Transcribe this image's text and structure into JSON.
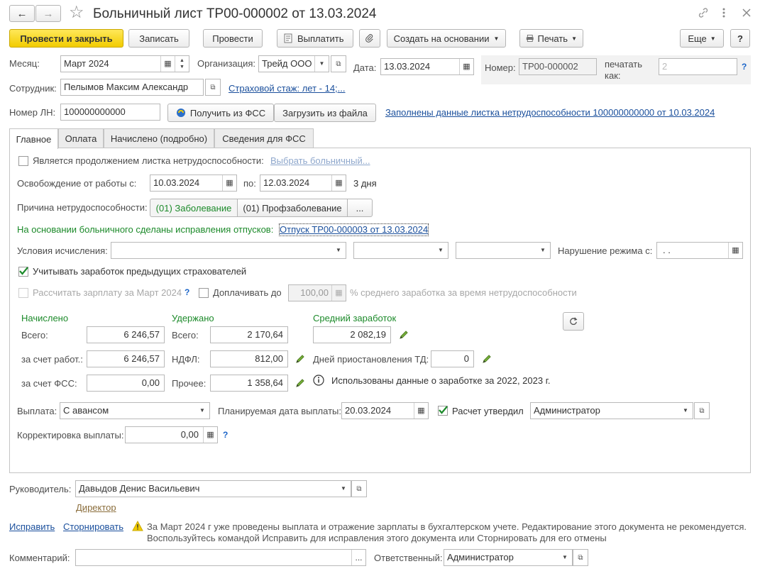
{
  "window": {
    "title": "Больничный лист ТР00-000002 от 13.03.2024",
    "back": "←",
    "forward": "→",
    "star": "☆"
  },
  "toolbar": {
    "post_close": "Провести и закрыть",
    "save": "Записать",
    "post": "Провести",
    "pay": "Выплатить",
    "create_based": "Создать на основании",
    "print": "Печать",
    "more": "Еще",
    "help": "?"
  },
  "header": {
    "month_label": "Месяц:",
    "month_value": "Март 2024",
    "org_label": "Организация:",
    "org_value": "Трейд ООО",
    "date_label": "Дата:",
    "date_value": "13.03.2024",
    "number_label": "Номер:",
    "number_value": "ТР00-000002",
    "print_as_label1": "печатать",
    "print_as_label2": "как:",
    "print_as_value": "2",
    "help": "?",
    "employee_label": "Сотрудник:",
    "employee_value": "Пелымов Максим Александр",
    "insurance_link": "Страховой стаж: лет - 14;...",
    "ln_label": "Номер ЛН:",
    "ln_value": "100000000000",
    "get_fss": "Получить из ФСС",
    "load_file": "Загрузить из файла",
    "filled_link": "Заполнены данные листка нетрудоспособности 100000000000 от 10.03.2024"
  },
  "tabs": [
    {
      "label": "Главное"
    },
    {
      "label": "Оплата"
    },
    {
      "label": "Начислено (подробно)"
    },
    {
      "label": "Сведения для ФСС"
    }
  ],
  "main": {
    "continuation_label": "Является продолжением листка нетрудоспособности:",
    "choose_sick": "Выбрать больничный...",
    "release_label": "Освобождение от работы с:",
    "release_from": "10.03.2024",
    "to_label": "по:",
    "release_to": "12.03.2024",
    "days": "3 дня",
    "reason_label": "Причина нетрудоспособности:",
    "reason_opt1": "(01) Заболевание",
    "reason_opt2": "(01) Профзаболевание",
    "reason_more": "...",
    "vacation_note": "На основании больничного сделаны исправления отпусков:",
    "vacation_link": "Отпуск ТР00-000003 от 13.03.2024",
    "conditions_label": "Условия исчисления:",
    "violation_label": "Нарушение режима с:",
    "violation_value": " .  .",
    "prev_insurers_label": "Учитывать заработок предыдущих страхователей",
    "calc_salary_label": "Рассчитать зарплату за Март 2024",
    "calc_help": "?",
    "extra_pay_label": "Доплачивать до",
    "extra_pay_value": "100,00",
    "extra_pay_suffix": "% среднего заработка за время нетрудоспособности",
    "accrued_title": "Начислено",
    "withheld_title": "Удержано",
    "avg_title": "Средний заработок",
    "total_label": "Всего:",
    "accrued_total": "6 246,57",
    "employer_label": "за счет работ.:",
    "accrued_employer": "6 246,57",
    "fss_label": "за счет ФСС:",
    "accrued_fss": "0,00",
    "withheld_total_label": "Всего:",
    "withheld_total": "2 170,64",
    "ndfl_label": "НДФЛ:",
    "ndfl_value": "812,00",
    "other_label": "Прочее:",
    "other_value": "1 358,64",
    "avg_value": "2 082,19",
    "suspension_label": "Дней приостановления ТД:",
    "suspension_value": "0",
    "info_text": "Использованы данные о заработке за  2022,  2023 г.",
    "payout_label": "Выплата:",
    "payout_value": "С авансом",
    "planned_date_label": "Планируемая дата выплаты:",
    "planned_date_value": "20.03.2024",
    "approved_label": "Расчет утвердил",
    "approved_value": "Администратор",
    "correction_label": "Корректировка выплаты:",
    "correction_value": "0,00",
    "correction_help": "?"
  },
  "footer": {
    "manager_label": "Руководитель:",
    "manager_value": "Давыдов Денис Васильевич",
    "position_link": "Директор",
    "fix_link": "Исправить",
    "reverse_link": "Сторнировать",
    "warning_line1": "За Март 2024 г уже проведены выплата и отражение зарплаты в бухгалтерском учете. Редактирование этого документа не рекомендуется.",
    "warning_line2": "Воспользуйтесь командой Исправить для исправления этого документа или Сторнировать для его отмены",
    "comment_label": "Комментарий:",
    "comment_more": "...",
    "responsible_label": "Ответственный:",
    "responsible_value": "Администратор"
  },
  "colors": {
    "primary": "#f2cc00",
    "link": "#1a4f9c",
    "green": "#1c8a2a"
  }
}
